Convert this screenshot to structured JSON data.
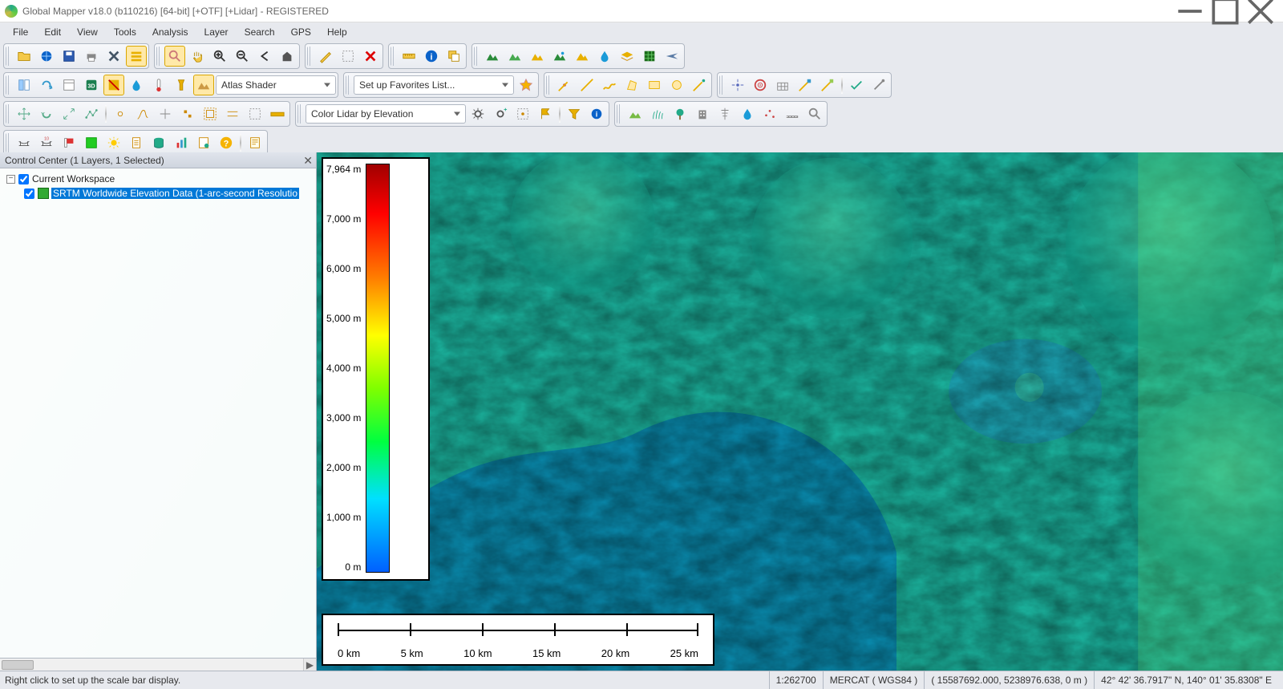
{
  "window": {
    "title": "Global Mapper v18.0 (b110216) [64-bit] [+OTF] [+Lidar] - REGISTERED"
  },
  "menu": [
    "File",
    "Edit",
    "View",
    "Tools",
    "Analysis",
    "Layer",
    "Search",
    "GPS",
    "Help"
  ],
  "toolbar_combos": {
    "shader": "Atlas Shader",
    "favorites": "Set up Favorites List...",
    "lidar": "Color Lidar by Elevation"
  },
  "control_center": {
    "title": "Control Center (1 Layers, 1 Selected)",
    "root": "Current Workspace",
    "layer": "SRTM Worldwide Elevation Data (1-arc-second Resolutio"
  },
  "legend_ticks": [
    "7,964 m",
    "7,000 m",
    "6,000 m",
    "5,000 m",
    "4,000 m",
    "3,000 m",
    "2,000 m",
    "1,000 m",
    "0 m"
  ],
  "scalebar_ticks": [
    "0 km",
    "5 km",
    "10 km",
    "15 km",
    "20 km",
    "25 km"
  ],
  "status": {
    "left": "Right click to set up the scale bar display.",
    "scale": "1:262700",
    "proj": "MERCAT ( WGS84 )",
    "xyz": "( 15587692.000, 5238976.638, 0 m )",
    "latlon": "42° 42' 36.7917\" N, 140° 01' 35.8308\" E"
  }
}
